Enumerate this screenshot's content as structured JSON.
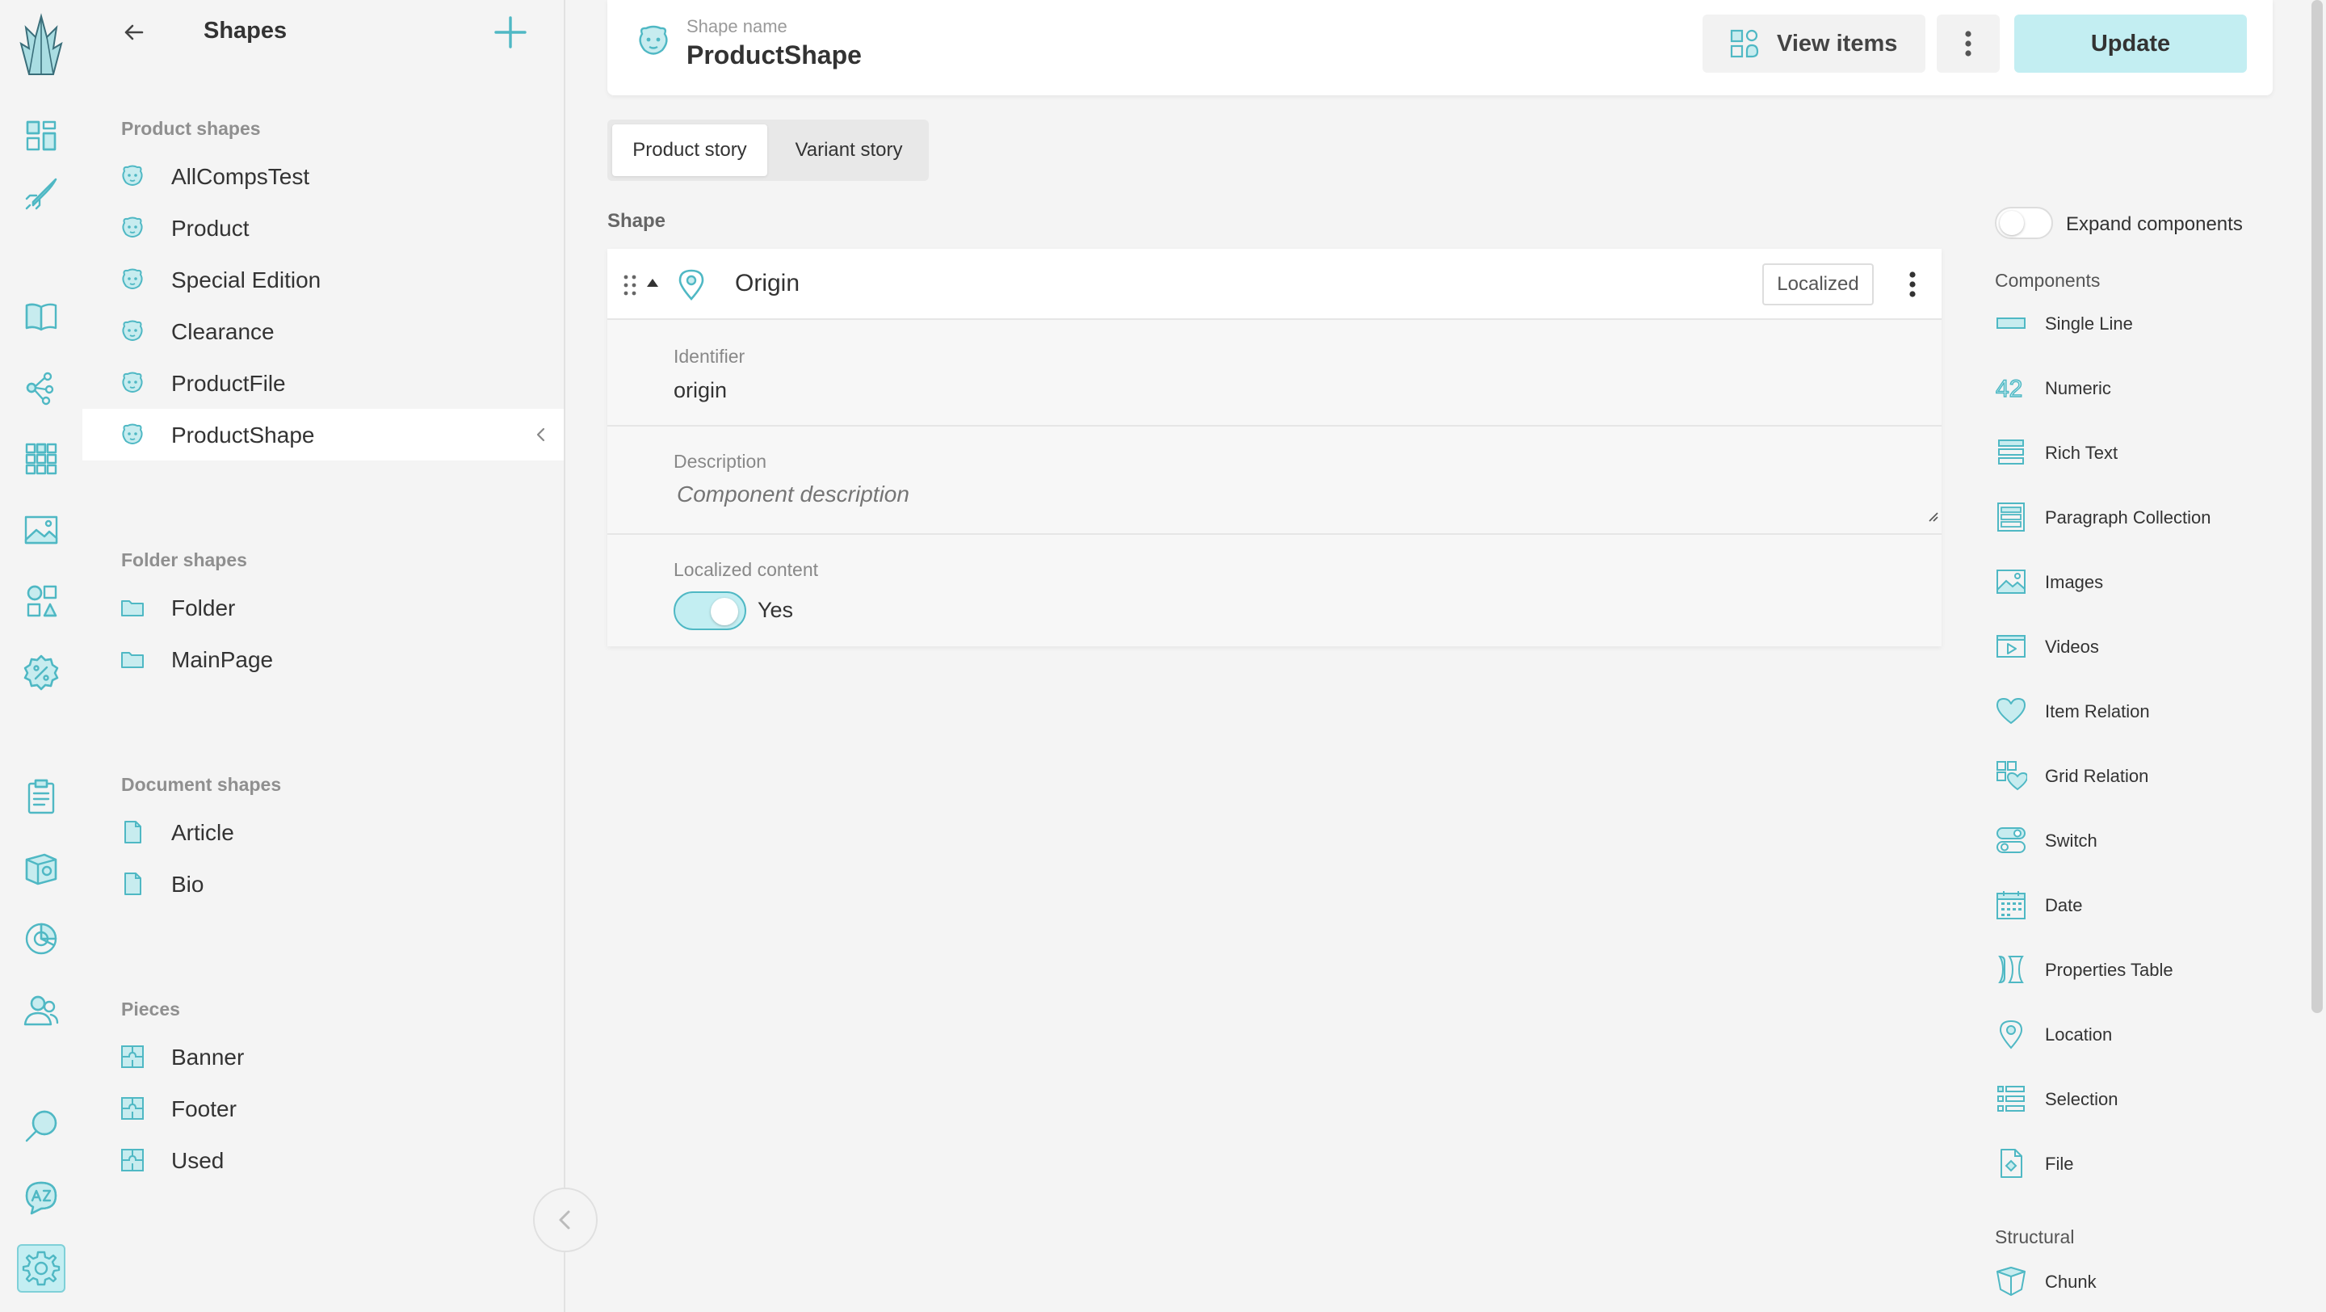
{
  "rail": {
    "icons": [
      "crystallize-logo-icon",
      "dashboard-icon",
      "rocket-icon",
      "catalogue-book-icon",
      "topics-icon",
      "grids-icon",
      "image-icon",
      "pieces-icon",
      "discount-icon",
      "orders-icon",
      "subscriptions-icon",
      "analytics-icon",
      "customers-icon",
      "search-icon",
      "translate-icon",
      "settings-icon"
    ],
    "active": "settings-icon"
  },
  "sidebar": {
    "title": "Shapes",
    "sections": [
      {
        "label": "Product shapes",
        "items": [
          "AllCompsTest",
          "Product",
          "Special Edition",
          "Clearance",
          "ProductFile",
          "ProductShape"
        ]
      },
      {
        "label": "Folder shapes",
        "items": [
          "Folder",
          "MainPage"
        ]
      },
      {
        "label": "Document shapes",
        "items": [
          "Article",
          "Bio"
        ]
      },
      {
        "label": "Pieces",
        "items": [
          "Banner",
          "Footer",
          "Used"
        ]
      }
    ],
    "active_item": "ProductShape"
  },
  "header": {
    "shape_name_label": "Shape name",
    "shape_name": "ProductShape",
    "view_items_label": "View items",
    "update_label": "Update"
  },
  "tabs": [
    "Product story",
    "Variant story"
  ],
  "active_tab": "Product story",
  "shape_section_label": "Shape",
  "component": {
    "name": "Origin",
    "badge": "Localized",
    "identifier_label": "Identifier",
    "identifier_value": "origin",
    "description_label": "Description",
    "description_placeholder": "Component description",
    "localized_label": "Localized content",
    "localized_value": "Yes",
    "localized_on": true
  },
  "components_panel": {
    "expand_label": "Expand components",
    "expand_on": false,
    "title": "Components",
    "items": [
      {
        "label": "Single Line",
        "icon": "single-line-icon"
      },
      {
        "label": "Numeric",
        "icon": "numeric-icon"
      },
      {
        "label": "Rich Text",
        "icon": "rich-text-icon"
      },
      {
        "label": "Paragraph Collection",
        "icon": "paragraph-collection-icon"
      },
      {
        "label": "Images",
        "icon": "images-icon"
      },
      {
        "label": "Videos",
        "icon": "videos-icon"
      },
      {
        "label": "Item Relation",
        "icon": "heart-icon"
      },
      {
        "label": "Grid Relation",
        "icon": "grid-relation-icon"
      },
      {
        "label": "Switch",
        "icon": "switch-icon"
      },
      {
        "label": "Date",
        "icon": "calendar-icon"
      },
      {
        "label": "Properties Table",
        "icon": "properties-table-icon"
      },
      {
        "label": "Location",
        "icon": "location-pin-icon"
      },
      {
        "label": "Selection",
        "icon": "selection-list-icon"
      },
      {
        "label": "File",
        "icon": "file-icon"
      }
    ],
    "structural_title": "Structural",
    "structural_items": [
      {
        "label": "Chunk",
        "icon": "chunk-icon"
      }
    ],
    "numeric_icon_text": "42"
  }
}
